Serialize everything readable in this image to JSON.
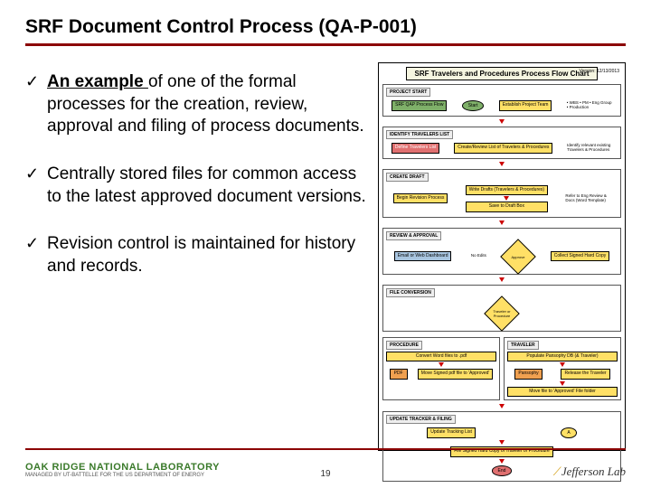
{
  "title": "SRF Document Control Process (QA-P-001)",
  "bullets": [
    {
      "lead": "An example ",
      "rest": "of one of the formal processes for the creation, review, approval and filing of process documents."
    },
    {
      "lead": "",
      "rest": "Centrally stored files for common access to the latest approved document versions."
    },
    {
      "lead": "",
      "rest": "Revision control is maintained for history and records."
    }
  ],
  "flowchart": {
    "title": "SRF Travelers and Procedures Process Flow Chart",
    "version": "Version: 12/13/2013",
    "sections": {
      "s1": {
        "label": "PROJECT START",
        "start": "Start",
        "b1": "SRF QAP Process Flow",
        "b2": "Establish Project Team",
        "note": "• WBS\n• PM\n• Eng Group\n• Production"
      },
      "s2": {
        "label": "IDENTIFY TRAVELERS LIST",
        "b1": "Define Travelers List",
        "b2": "Create/Review List of Travelers & Procedures",
        "note": "Identify relevant existing Travelers & Procedures"
      },
      "s3": {
        "label": "CREATE DRAFT",
        "b1": "Begin Revision Process",
        "b2": "Write Drafts (Travelers & Procedures)",
        "b3": "Save to Draft Box",
        "note": "Refer to Eng Review & Docs (Word Template)"
      },
      "s4": {
        "label": "REVIEW & APPROVAL",
        "b1": "Email or Web Dashboard",
        "d1": "Approve",
        "b2": "Collect Signed Hard Copy",
        "no": "No Edits"
      },
      "s5": {
        "label": "FILE CONVERSION",
        "d1": "Traveler or Procedure"
      },
      "s6": {
        "left_label": "PROCEDURE",
        "right_label": "TRAVELER",
        "l1": "Convert Word files to .pdf",
        "l2": "Move Signed pdf file to 'Approved'",
        "r1": "Populate Pansophy DB (& Traveler)",
        "r2": "Release the Traveler",
        "r3": "Move file to 'Approved' File folder",
        "pdf": "PDF",
        "pan": "Pansophy"
      },
      "s7": {
        "label": "UPDATE TRACKER & FILING",
        "b1": "Update Tracking List",
        "b2": "File Signed Hard Copy of Traveler or Procedure",
        "end": "End",
        "a": "A"
      }
    }
  },
  "footer": {
    "oak_main": "OAK RIDGE NATIONAL LABORATORY",
    "oak_sub": "MANAGED BY UT-BATTELLE FOR THE US DEPARTMENT OF ENERGY",
    "page": "19",
    "jlab": "Jefferson Lab"
  }
}
